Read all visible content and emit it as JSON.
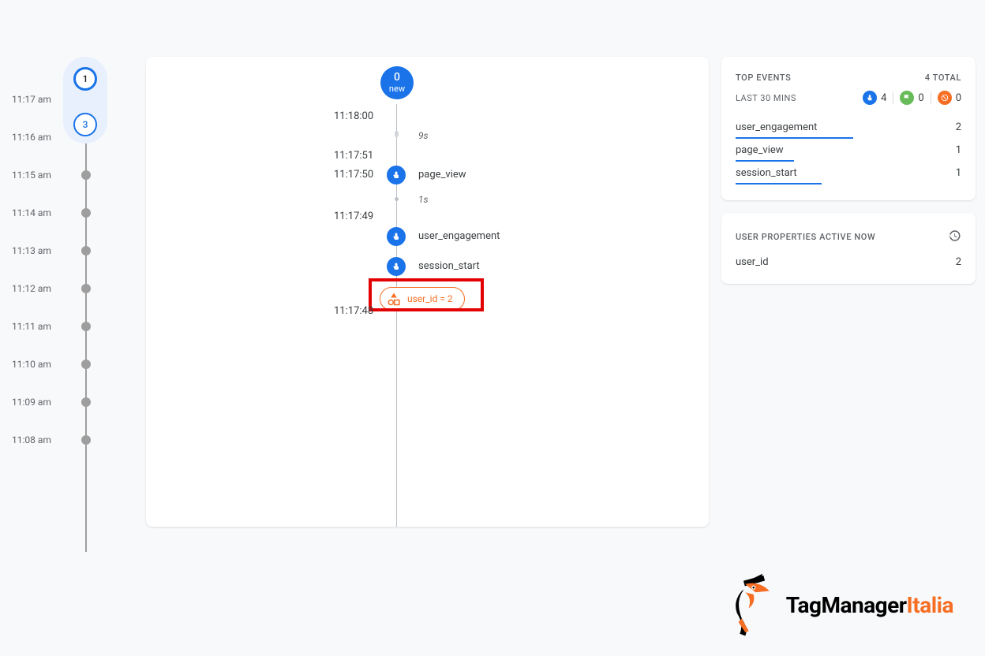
{
  "leftTimeline": {
    "badges": {
      "b1": "1",
      "b3": "3"
    },
    "minutes": [
      "11:17 am",
      "11:16 am",
      "11:15 am",
      "11:14 am",
      "11:13 am",
      "11:12 am",
      "11:11 am",
      "11:10 am",
      "11:09 am",
      "11:08 am"
    ]
  },
  "center": {
    "head": {
      "num": "0",
      "sub": "new"
    },
    "times": {
      "t1": "11:18:00",
      "t2": "11:17:51",
      "t3": "11:17:50",
      "t4": "11:17:49",
      "t5": "11:17:48"
    },
    "gaps": {
      "g1": "9s",
      "g2": "1s"
    },
    "events": {
      "e1": "page_view",
      "e2": "user_engagement",
      "e3": "session_start"
    },
    "userPill": "user_id = 2"
  },
  "topEvents": {
    "title": "TOP EVENTS",
    "total": "4 TOTAL",
    "last30": "LAST 30 MINS",
    "stats": {
      "blue": "4",
      "green": "0",
      "orange": "0"
    },
    "list": [
      {
        "name": "user_engagement",
        "count": "2",
        "bar": 52
      },
      {
        "name": "page_view",
        "count": "1",
        "bar": 26
      },
      {
        "name": "session_start",
        "count": "1",
        "bar": 38
      }
    ]
  },
  "userProps": {
    "title": "USER PROPERTIES ACTIVE NOW",
    "rows": [
      {
        "name": "user_id",
        "val": "2"
      }
    ]
  },
  "logo": {
    "tm": "TagManager",
    "it": "Italia"
  }
}
